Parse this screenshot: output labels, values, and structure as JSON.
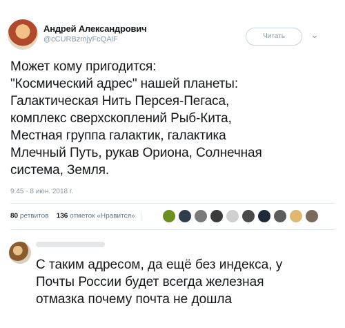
{
  "tweet": {
    "author_name": "Андрей Александрович",
    "author_handle": "@cCURBzmjyFcQAiF",
    "follow_label": "Читать",
    "menu_icon": "chevron-down-icon",
    "text": "Может кому пригодится:\n\"Космический адрес\" нашей планеты:\nГалактическая Нить Персея-Пегаса,\nкомплекс сверхскоплений Рыб-Кита,\nМестная группа галактик, галактика\nМлечный Путь, рукав Ориона, Солнечная\nсистема, Земля.",
    "timestamp": "9:45 - 8 июн. 2018 г.",
    "retweets_count": "80",
    "retweets_label": "ретвитов",
    "likes_count": "136",
    "likes_label": "отметок «Нравится»",
    "liker_colors": [
      "#6b8e23",
      "#2f3d4a",
      "#7a7a7a",
      "#3b3b3b",
      "#d0d0d0",
      "#4a4a4a",
      "#1e2a38",
      "#5c5c5c",
      "#e0b870",
      "#7a6a5a"
    ]
  },
  "reply": {
    "text": "С таким адресом, да ещё без индекса, у\nПочты России будет всегда железная\nотмазка почему почта не дошла"
  }
}
